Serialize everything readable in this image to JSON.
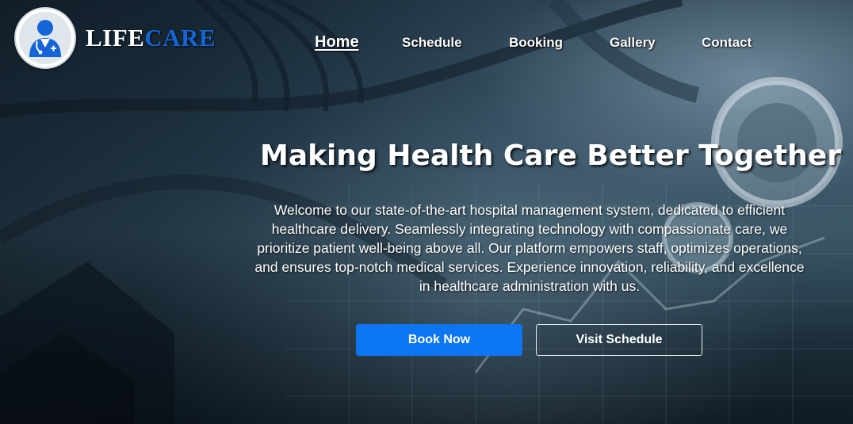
{
  "brand": {
    "part1": "LIFE",
    "part2": "CARE",
    "logo_icon": "doctor-avatar-icon"
  },
  "nav": {
    "items": [
      {
        "label": "Home",
        "active": true
      },
      {
        "label": "Schedule",
        "active": false
      },
      {
        "label": "Booking",
        "active": false
      },
      {
        "label": "Gallery",
        "active": false
      },
      {
        "label": "Contact",
        "active": false
      }
    ]
  },
  "hero": {
    "title": "Making Health Care Better Together",
    "description": "Welcome to our state-of-the-art hospital management system, dedicated to efficient healthcare delivery. Seamlessly integrating technology with compassionate care, we prioritize patient well-being above all. Our platform empowers staff, optimizes operations, and ensures top-notch medical services. Experience innovation, reliability, and excellence in healthcare administration with us.",
    "primary_button": "Book Now",
    "secondary_button": "Visit Schedule",
    "background": "stethoscope-and-notebook-photo"
  },
  "colors": {
    "brand_blue": "#1565d8",
    "primary_button": "#0d76f2",
    "text": "#ffffff"
  }
}
